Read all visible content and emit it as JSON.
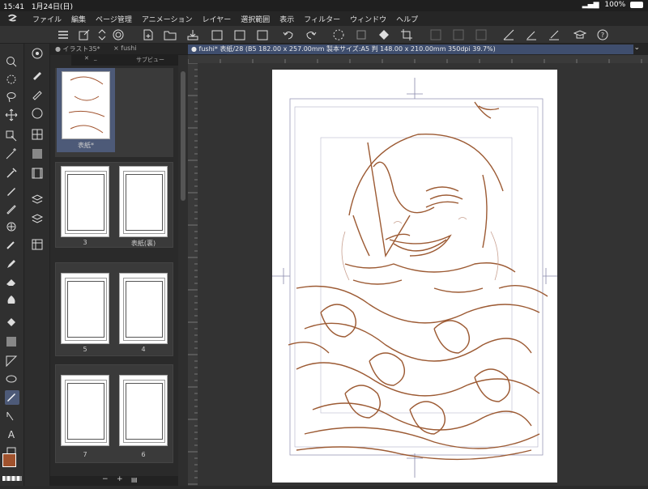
{
  "status": {
    "time": "15:41",
    "date": "1月24日(日)",
    "battery": "100%"
  },
  "menu": [
    "ファイル",
    "編集",
    "ページ管理",
    "アニメーション",
    "レイヤー",
    "選択範囲",
    "表示",
    "フィルター",
    "ウィンドウ",
    "ヘルプ"
  ],
  "tabs": [
    {
      "label": "イラスト35*"
    },
    {
      "label": "fushi"
    },
    {
      "label": "fushi* 表紙/28 (B5 182.00 x 257.00mm 製本サイズ:A5 判 148.00 x 210.00mm 350dpi 39.7%)"
    }
  ],
  "subview": {
    "title": "サブビュー"
  },
  "pages": [
    {
      "label": "表紙*"
    },
    {
      "label": "3"
    },
    {
      "label": "表紙(裏)"
    },
    {
      "label": "5"
    },
    {
      "label": "4"
    },
    {
      "label": "7"
    },
    {
      "label": "6"
    }
  ],
  "colors": {
    "main": "#a0522d",
    "sub": "#ffffff",
    "accent": "#4d5a78"
  },
  "icons": {
    "app_logo": "clip-studio-logo-icon",
    "menu": "hamburger-icon",
    "undo": "undo-icon",
    "redo": "redo-icon"
  }
}
